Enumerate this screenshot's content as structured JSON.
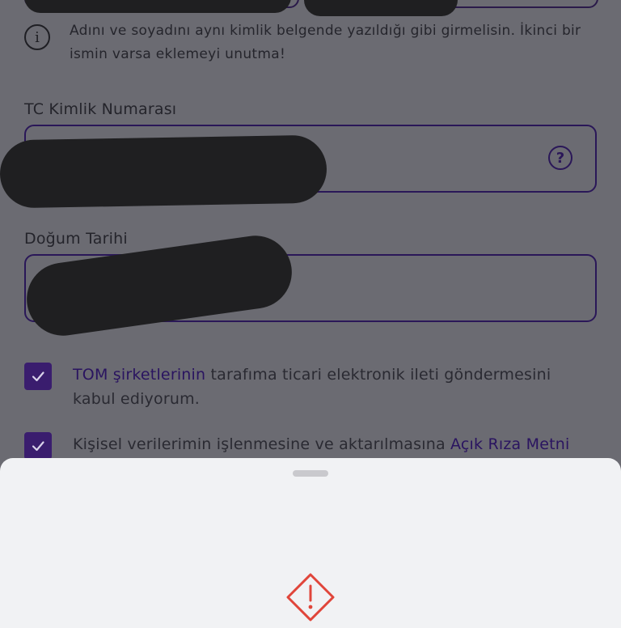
{
  "info": {
    "text": "Adını ve soyadını aynı kimlik belgende yazıldığı gibi girmelisin. İkinci bir ismin varsa eklemeyi unutma!",
    "icon": "info-icon"
  },
  "fields": {
    "tc": {
      "label": "TC Kimlik Numarası",
      "help_icon": "help-icon",
      "help_glyph": "?"
    },
    "birth": {
      "label": "Doğum Tarihi"
    }
  },
  "consents": {
    "commercial": {
      "link": "TOM şirketlerinin",
      "text": " tarafıma ticari elektronik ileti göndermesini kabul ediyorum.",
      "checked": true
    },
    "personal_data": {
      "text": "Kişisel verilerimin işlenmesine ve aktarılmasına ",
      "link": "Açık Rıza Metni",
      "checked": true
    }
  },
  "sheet": {
    "warning_icon": "warning-icon",
    "warning_color": "#e0453a"
  },
  "colors": {
    "accent": "#3a1d6e",
    "link": "#2a1460",
    "overlay": "#6b6b72",
    "sheet_bg": "#f1f2f4"
  }
}
